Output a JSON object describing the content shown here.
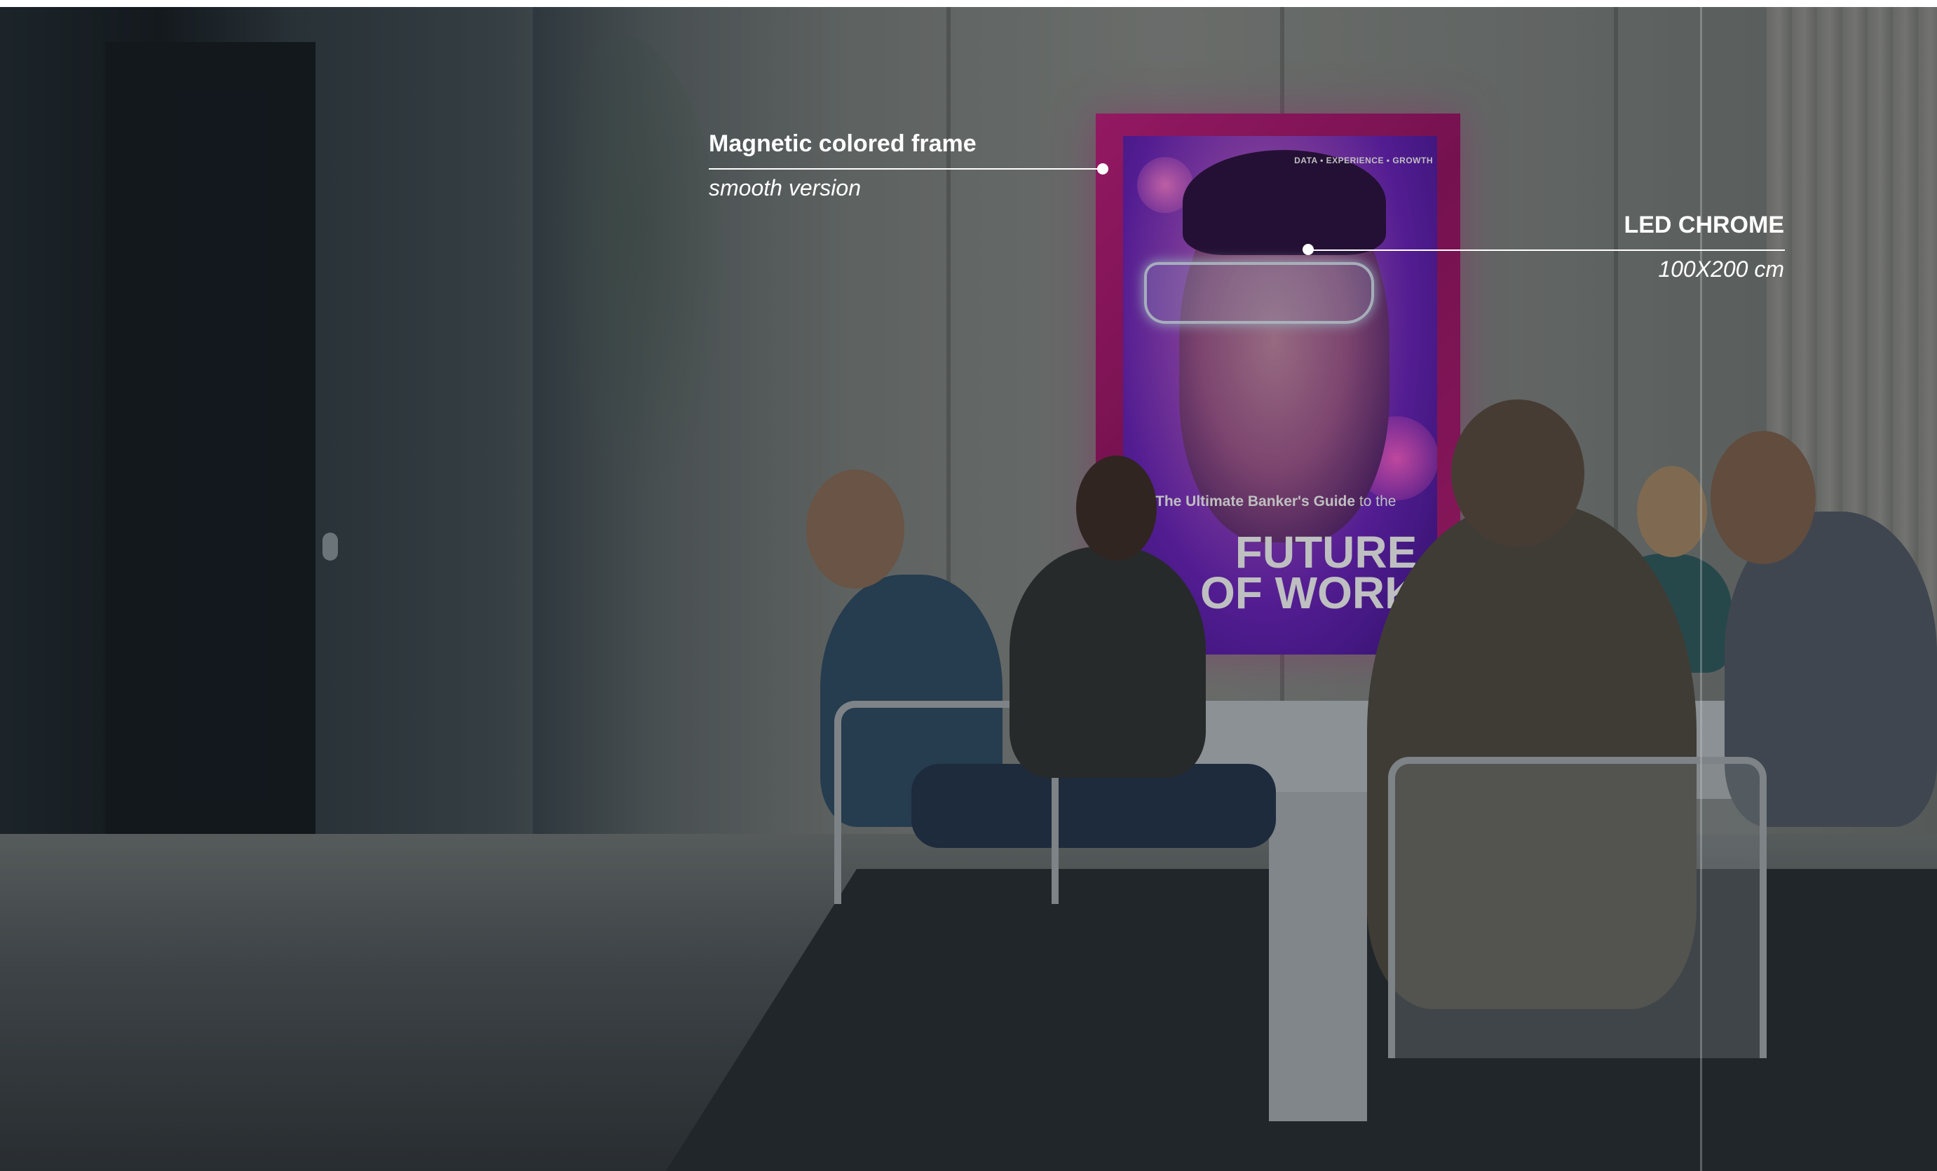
{
  "poster": {
    "header": "DATA • EXPERIENCE • GROWTH",
    "subtitle_bold": "The Ultimate Banker's Guide",
    "subtitle_light": "to the",
    "title": "FUTURE\nOF WORK"
  },
  "annotations": {
    "frame": {
      "title": "Magnetic colored frame",
      "subtitle": "smooth version"
    },
    "led": {
      "title": "LED CHROME",
      "subtitle": "100X200 cm"
    }
  },
  "colors": {
    "frame": "#b71776",
    "poster_glow": "#6b1fbf",
    "annotation_text": "#ffffff"
  }
}
